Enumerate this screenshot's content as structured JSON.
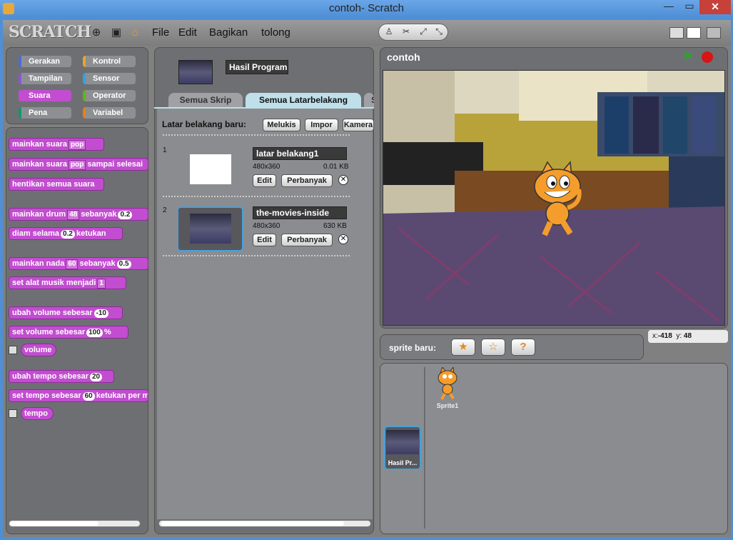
{
  "window": {
    "title": "contoh- Scratch",
    "minimize": "—",
    "maximize": "▭",
    "close": "✕"
  },
  "logo": "SCRATCH",
  "menu": [
    "File",
    "Edit",
    "Bagikan",
    "tolong"
  ],
  "categories": [
    {
      "label": "Gerakan",
      "color": "#4a6cd4"
    },
    {
      "label": "Kontrol",
      "color": "#e6a822"
    },
    {
      "label": "Tampilan",
      "color": "#8a55d7"
    },
    {
      "label": "Sensor",
      "color": "#2ca5e2"
    },
    {
      "label": "Suara",
      "color": "#c24dd0"
    },
    {
      "label": "Operator",
      "color": "#5cb712"
    },
    {
      "label": "Pena",
      "color": "#0e9a6c"
    },
    {
      "label": "Variabel",
      "color": "#ee7d16"
    }
  ],
  "selected_category": "Suara",
  "blocks": {
    "b1": "mainkan suara",
    "b1_dd": "pop",
    "b2": "mainkan suara",
    "b2_dd": "pop",
    "b2_tail": "sampai selesai",
    "b3": "hentikan semua suara",
    "b4": "mainkan drum",
    "b4_dd": "48",
    "b4_tail": "sebanyak",
    "b4_val": "0.2",
    "b5": "diam selama",
    "b5_val": "0.2",
    "b5_tail": "ketukan",
    "b6": "mainkan nada",
    "b6_dd": "60",
    "b6_tail": "sebanyak",
    "b6_val": "0.5",
    "b7": "set alat musik menjadi",
    "b7_dd": "1",
    "b8": "ubah volume sebesar",
    "b8_val": "-10",
    "b9": "set volume sebesar",
    "b9_val": "100",
    "b9_tail": "%",
    "b10": "volume",
    "b11": "ubah tempo sebesar",
    "b11_val": "20",
    "b12": "set tempo sebesar",
    "b12_val": "60",
    "b12_tail": "ketukan per menit",
    "b13": "tempo"
  },
  "sprite_name": "Hasil Program",
  "tabs": [
    "Semua Skrip",
    "Semua Latarbelakang",
    "Suara"
  ],
  "active_tab": "Semua Latarbelakang",
  "new_backdrop": {
    "label": "Latar belakang baru:",
    "paint": "Melukis",
    "import": "Impor",
    "camera": "Kamera"
  },
  "backdrops": [
    {
      "index": "1",
      "name": "latar belakang1",
      "size": "480x360",
      "kb": "0.01 KB",
      "edit": "Edit",
      "copy": "Perbanyak"
    },
    {
      "index": "2",
      "name": "the-movies-inside",
      "size": "480x360",
      "kb": "630 KB",
      "edit": "Edit",
      "copy": "Perbanyak"
    }
  ],
  "stage": {
    "title": "contoh",
    "x_label": "x:",
    "x": "-418",
    "y_label": "y:",
    "y": "48"
  },
  "new_sprite_label": "sprite baru:",
  "sprites": [
    {
      "name": "Sprite1"
    }
  ],
  "stage_thumb_label": "Hasil Pr..."
}
